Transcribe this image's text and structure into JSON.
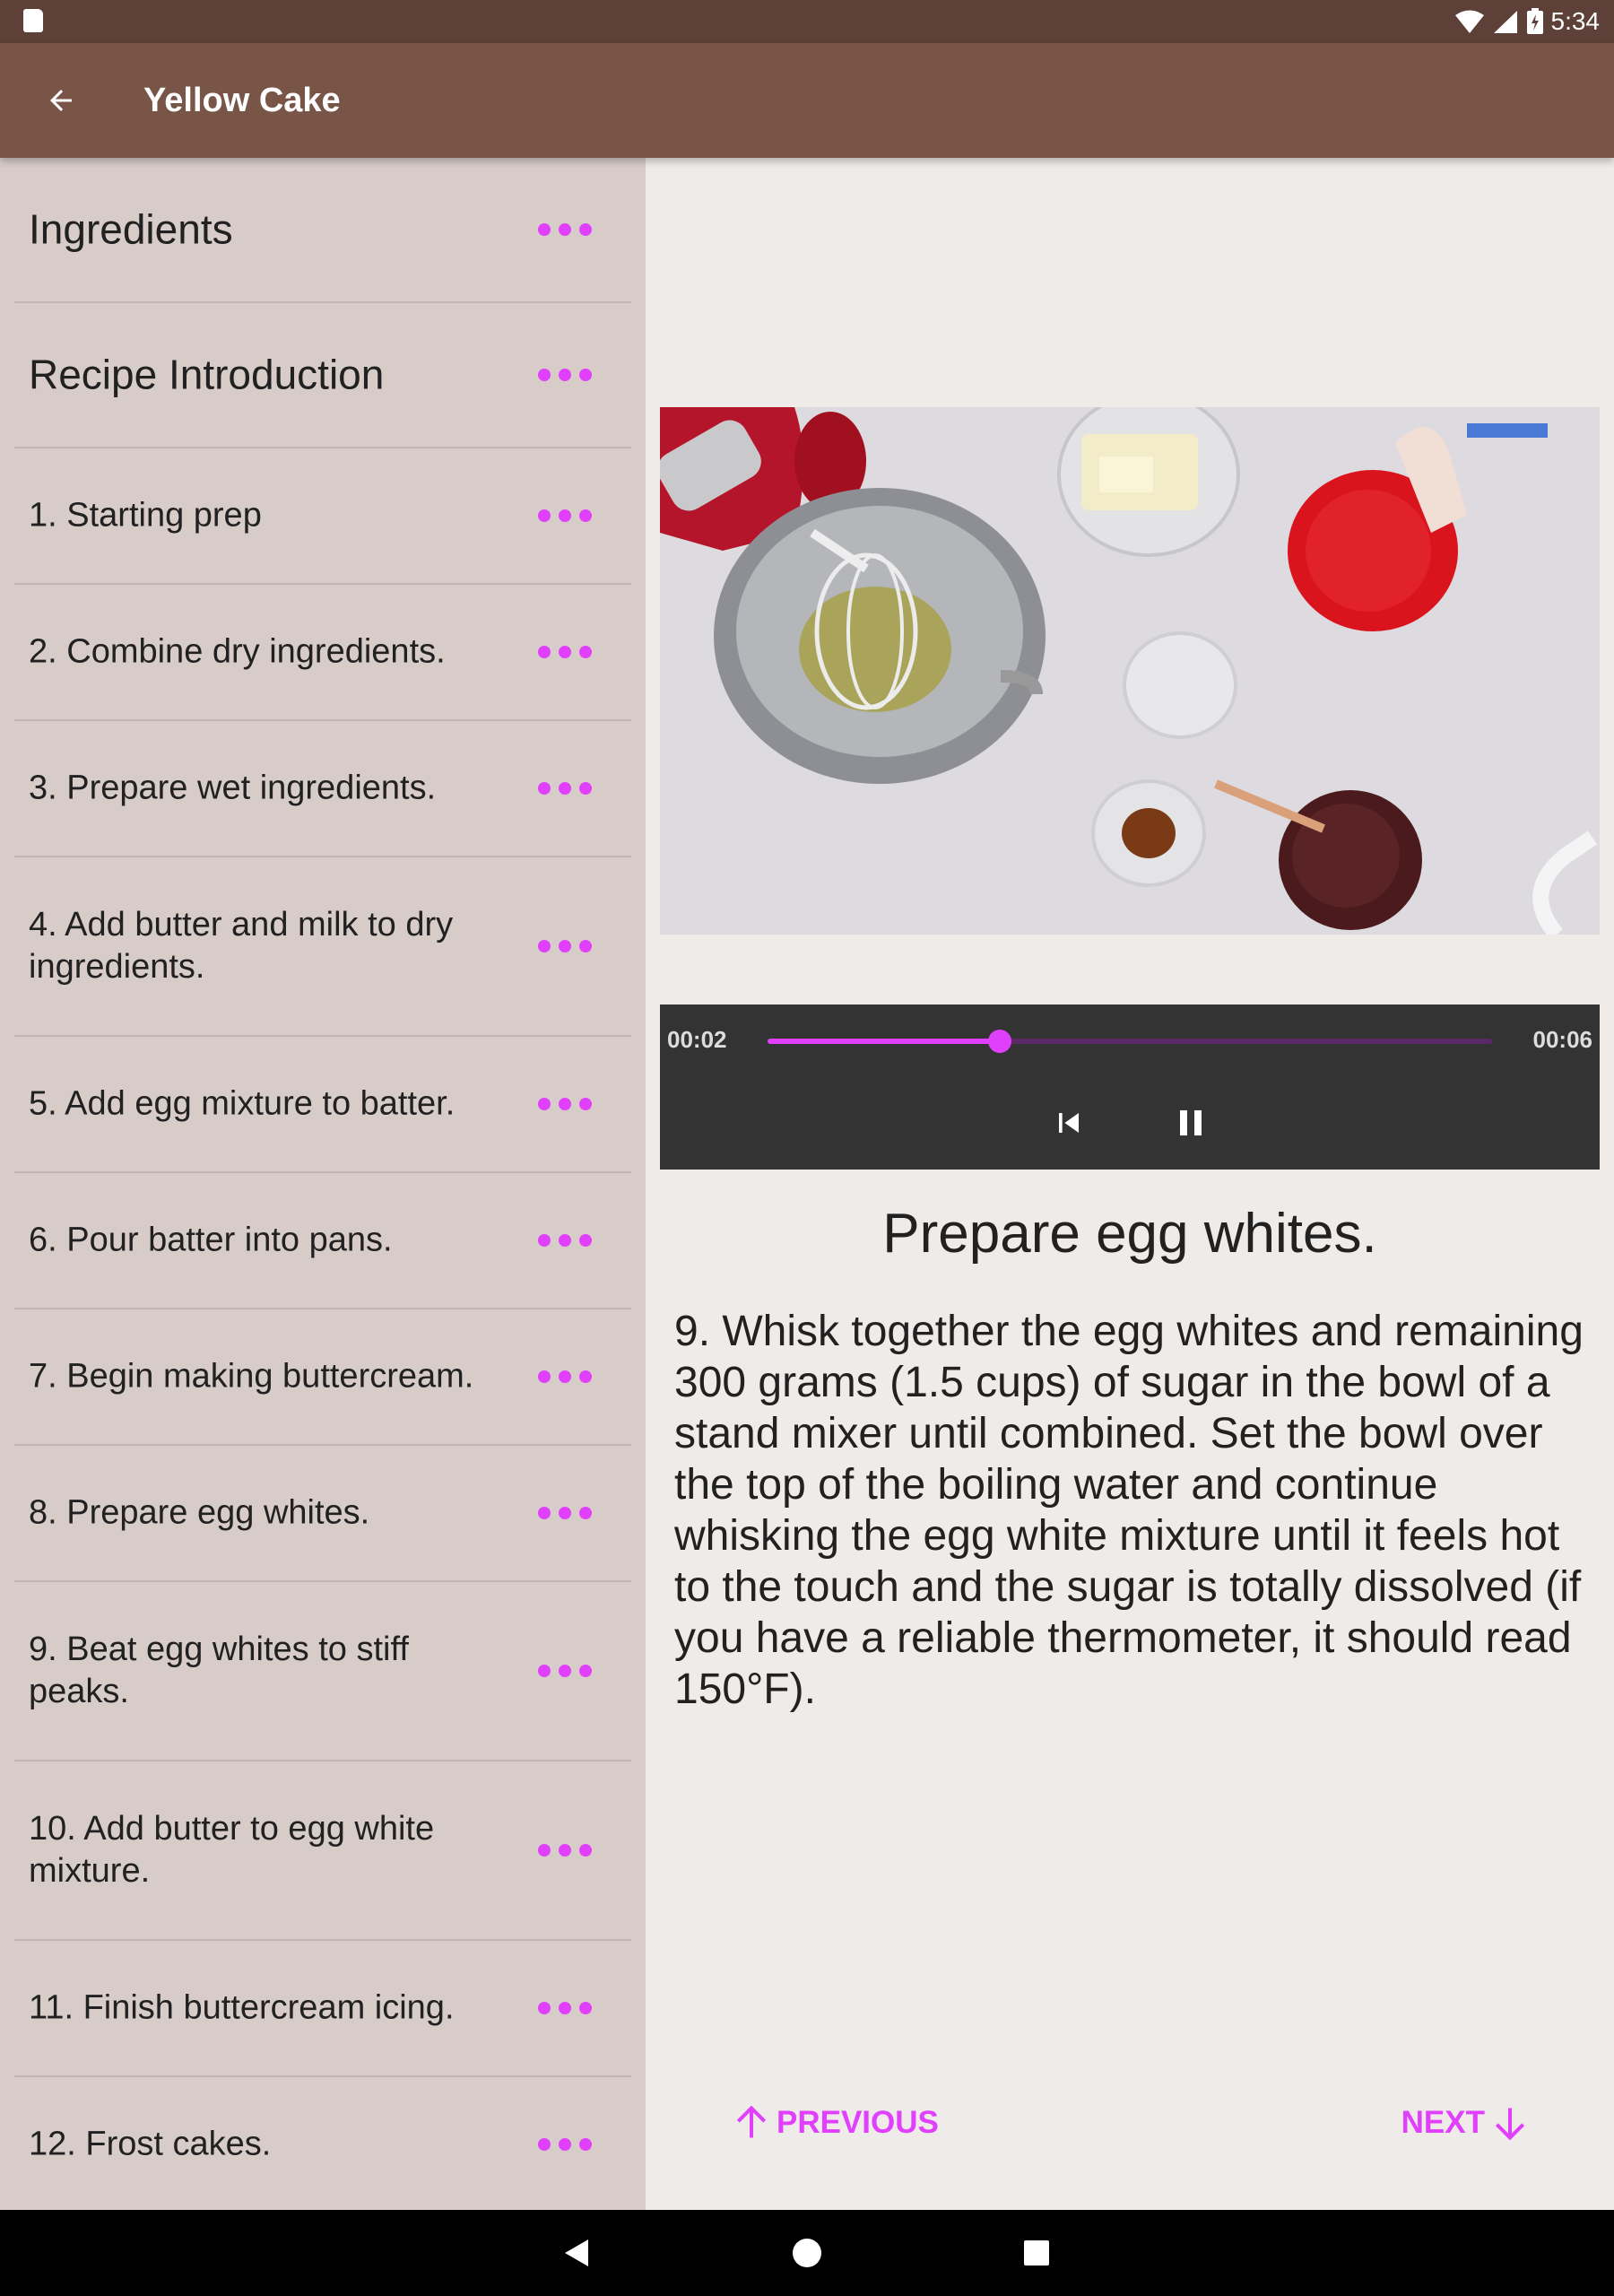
{
  "status_bar": {
    "time": "5:34"
  },
  "app_bar": {
    "title": "Yellow Cake"
  },
  "steps": [
    {
      "label": "Ingredients"
    },
    {
      "label": "Recipe Introduction"
    },
    {
      "label": "1. Starting prep"
    },
    {
      "label": "2. Combine dry ingredients."
    },
    {
      "label": "3. Prepare wet ingredients."
    },
    {
      "label": "4. Add butter and milk to dry ingredients."
    },
    {
      "label": "5. Add egg mixture to batter."
    },
    {
      "label": "6. Pour batter into pans."
    },
    {
      "label": "7. Begin making buttercream."
    },
    {
      "label": "8. Prepare egg whites."
    },
    {
      "label": "9. Beat egg whites to stiff peaks."
    },
    {
      "label": "10. Add butter to egg white mixture."
    },
    {
      "label": "11. Finish buttercream icing."
    },
    {
      "label": "12. Frost cakes."
    }
  ],
  "player": {
    "current_time": "00:02",
    "duration": "00:06",
    "progress_fraction": 0.32
  },
  "detail": {
    "title": "Prepare egg whites.",
    "description": "9. Whisk together the egg whites and remaining 300 grams (1.5 cups) of sugar in the bowl of a stand mixer until combined. Set the bowl over the top of the boiling water and continue whisking the egg white mixture until it feels hot to the touch and the sugar is totally dissolved (if you have a reliable thermometer, it should read 150°F)."
  },
  "navigation": {
    "previous_label": "PREVIOUS",
    "next_label": "NEXT"
  },
  "colors": {
    "status_bar": "#5d4037",
    "app_bar": "#795548",
    "sidebar": "#d7ccc8",
    "background": "#efebe9",
    "accent": "#e040fb",
    "player_controls": "#333333"
  },
  "icons": {
    "back": "arrow-left-icon",
    "more": "more-horizontal-icon",
    "previous": "arrow-up-icon",
    "next": "arrow-down-icon",
    "skip_previous": "skip-previous-icon",
    "pause": "pause-icon"
  }
}
